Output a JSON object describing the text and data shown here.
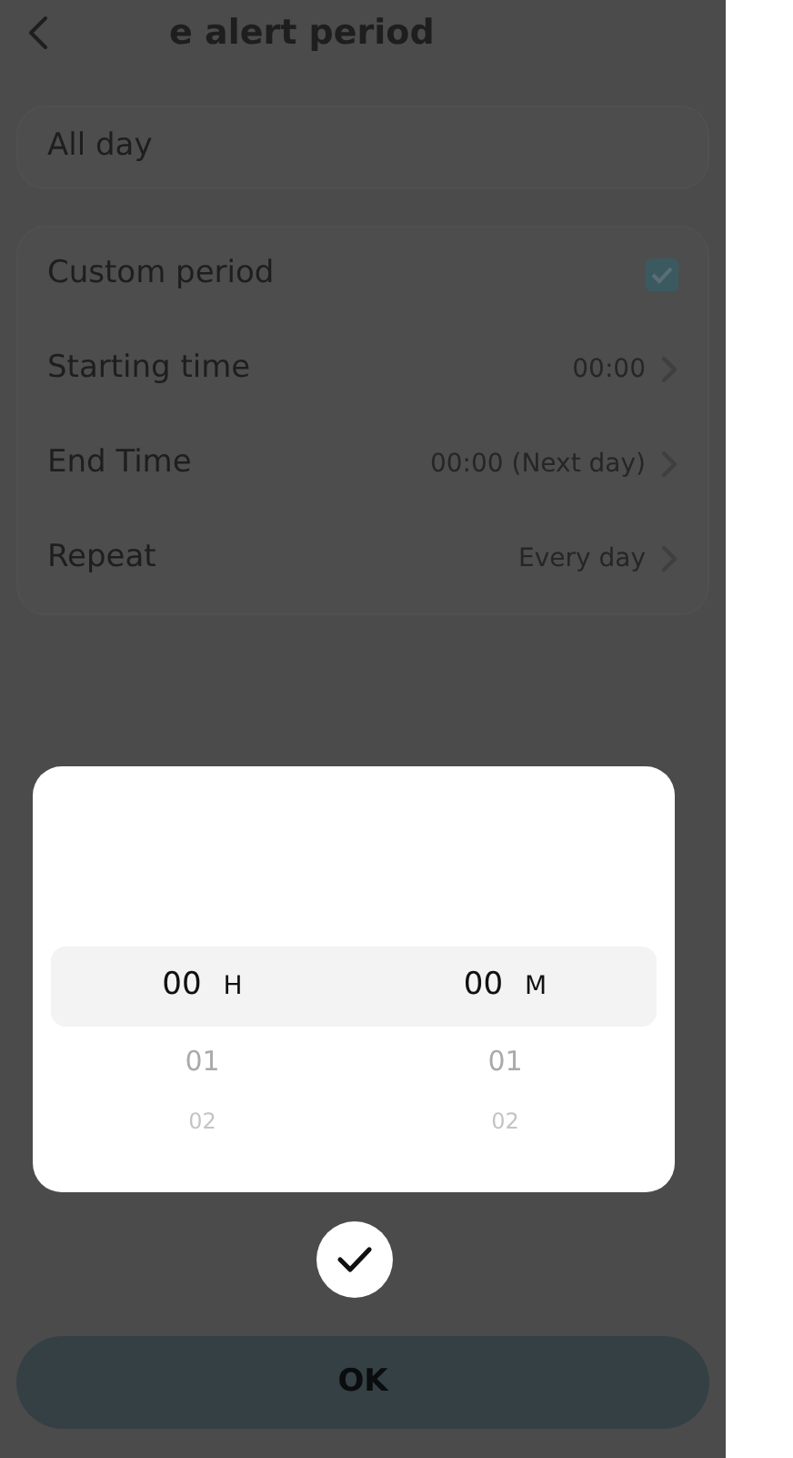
{
  "header": {
    "title": "e alert period"
  },
  "all_day": {
    "label": "All day"
  },
  "custom": {
    "rows": [
      {
        "kind": "checkbox",
        "label": "Custom period",
        "checked": true
      },
      {
        "kind": "value",
        "label": "Starting time",
        "value": "00:00"
      },
      {
        "kind": "value",
        "label": "End Time",
        "value": "00:00 (Next day)"
      },
      {
        "kind": "value",
        "label": "Repeat",
        "value": "Every day"
      }
    ]
  },
  "picker": {
    "columns": [
      {
        "unit": "H",
        "items": [
          {
            "text": "00",
            "selected": true
          },
          {
            "text": "01",
            "selected": false
          },
          {
            "text": "02",
            "selected": false
          }
        ]
      },
      {
        "unit": "M",
        "items": [
          {
            "text": "00",
            "selected": true
          },
          {
            "text": "01",
            "selected": false
          },
          {
            "text": "02",
            "selected": false
          }
        ]
      }
    ]
  },
  "ok_button": {
    "label": "OK"
  }
}
